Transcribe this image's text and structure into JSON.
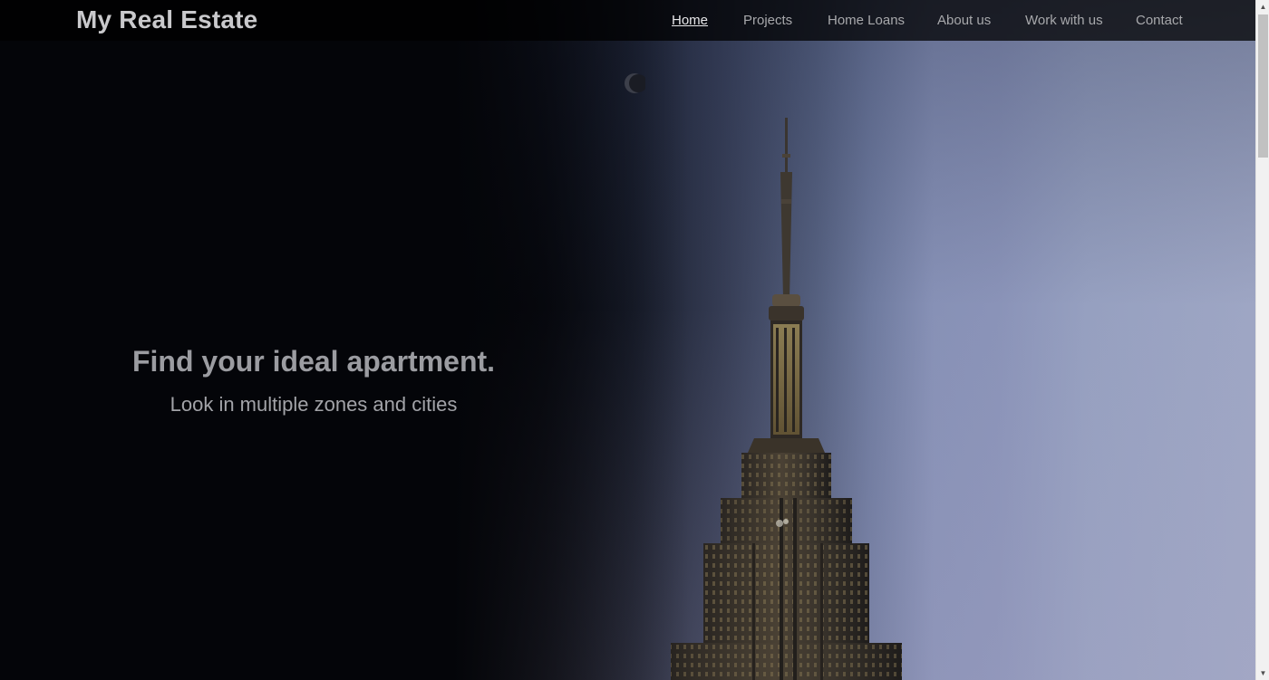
{
  "header": {
    "brand": "My Real Estate",
    "nav": [
      {
        "label": "Home",
        "active": true
      },
      {
        "label": "Projects",
        "active": false
      },
      {
        "label": "Home Loans",
        "active": false
      },
      {
        "label": "About us",
        "active": false
      },
      {
        "label": "Work with us",
        "active": false
      },
      {
        "label": "Contact",
        "active": false
      }
    ]
  },
  "hero": {
    "title": "Find your ideal apartment.",
    "subtitle": "Look in multiple zones and cities",
    "image": "empire-state-building-dusk"
  },
  "scrollbar": {
    "up_icon": "triangle-up-icon",
    "down_icon": "triangle-down-icon"
  },
  "colors": {
    "nav_bg": "#000000",
    "brand_text": "#c9c9cc",
    "nav_text": "#a7a8ab",
    "nav_active": "#e6e6e8",
    "hero_text": "#9b9ca1"
  }
}
